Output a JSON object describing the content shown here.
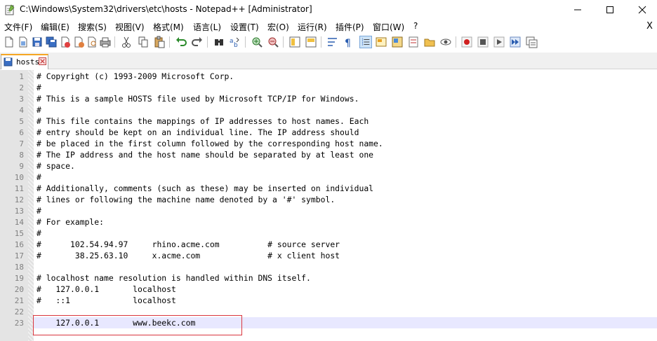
{
  "window": {
    "title": "C:\\Windows\\System32\\drivers\\etc\\hosts - Notepad++ [Administrator]"
  },
  "menu": {
    "items": [
      "文件(F)",
      "编辑(E)",
      "搜索(S)",
      "视图(V)",
      "格式(M)",
      "语言(L)",
      "设置(T)",
      "宏(O)",
      "运行(R)",
      "插件(P)",
      "窗口(W)",
      "?"
    ],
    "close_label": "X"
  },
  "tab": {
    "label": "hosts"
  },
  "editor": {
    "lines": [
      {
        "num": "1",
        "text": "# Copyright (c) 1993-2009 Microsoft Corp."
      },
      {
        "num": "2",
        "text": "#"
      },
      {
        "num": "3",
        "text": "# This is a sample HOSTS file used by Microsoft TCP/IP for Windows."
      },
      {
        "num": "4",
        "text": "#"
      },
      {
        "num": "5",
        "text": "# This file contains the mappings of IP addresses to host names. Each"
      },
      {
        "num": "6",
        "text": "# entry should be kept on an individual line. The IP address should"
      },
      {
        "num": "7",
        "text": "# be placed in the first column followed by the corresponding host name."
      },
      {
        "num": "8",
        "text": "# The IP address and the host name should be separated by at least one"
      },
      {
        "num": "9",
        "text": "# space."
      },
      {
        "num": "10",
        "text": "#"
      },
      {
        "num": "11",
        "text": "# Additionally, comments (such as these) may be inserted on individual"
      },
      {
        "num": "12",
        "text": "# lines or following the machine name denoted by a '#' symbol."
      },
      {
        "num": "13",
        "text": "#"
      },
      {
        "num": "14",
        "text": "# For example:"
      },
      {
        "num": "15",
        "text": "#"
      },
      {
        "num": "16",
        "text": "#      102.54.94.97     rhino.acme.com          # source server"
      },
      {
        "num": "17",
        "text": "#       38.25.63.10     x.acme.com              # x client host"
      },
      {
        "num": "18",
        "text": ""
      },
      {
        "num": "19",
        "text": "# localhost name resolution is handled within DNS itself."
      },
      {
        "num": "20",
        "text": "#   127.0.0.1       localhost"
      },
      {
        "num": "21",
        "text": "#   ::1             localhost"
      },
      {
        "num": "22",
        "text": ""
      },
      {
        "num": "23",
        "text": "    127.0.0.1       www.beekc.com"
      }
    ],
    "current_line": 23
  },
  "colors": {
    "current_line_bg": "#e8e8ff",
    "highlight_border": "#d9363e",
    "tab_accent": "#f5a623"
  }
}
